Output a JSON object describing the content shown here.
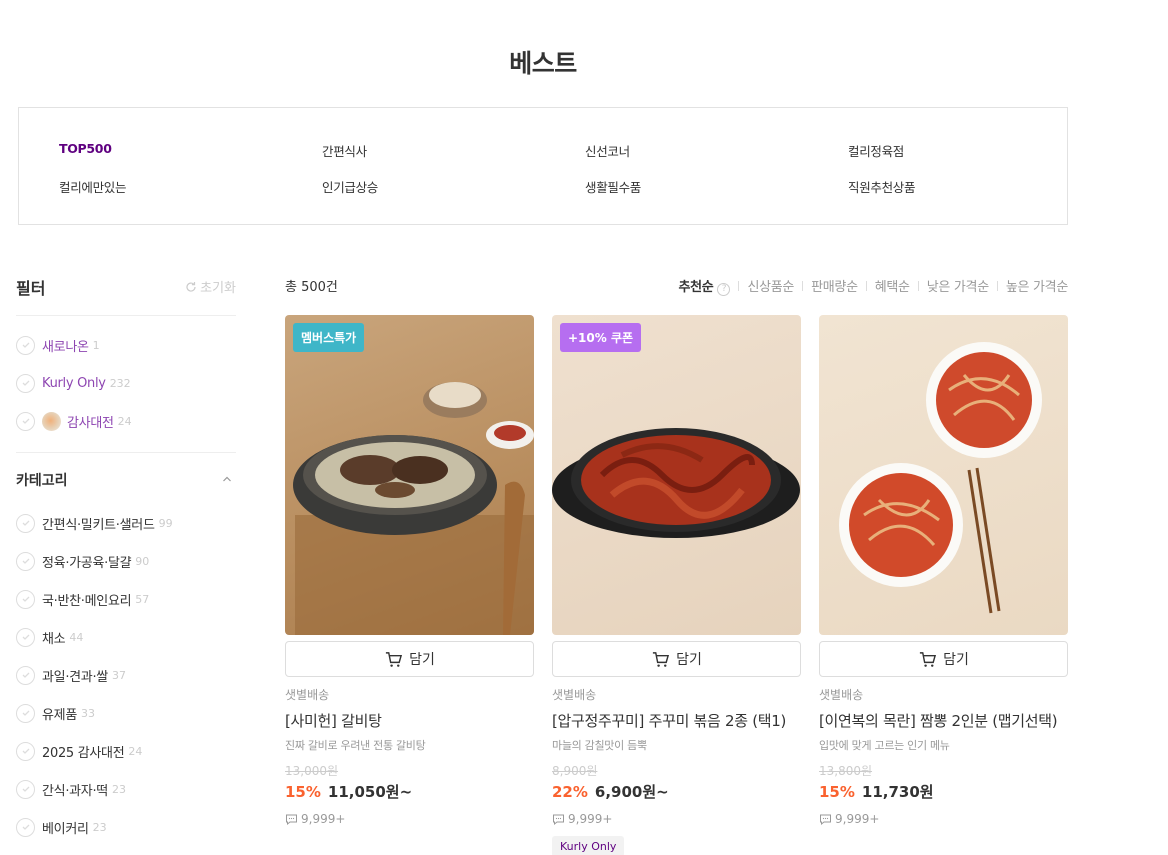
{
  "page": {
    "title": "베스트"
  },
  "categories": [
    {
      "label": "TOP500",
      "active": true
    },
    {
      "label": "간편식사"
    },
    {
      "label": "신선코너"
    },
    {
      "label": "컬리정육점"
    },
    {
      "label": "컬리에만있는"
    },
    {
      "label": "인기급상승"
    },
    {
      "label": "생활필수품"
    },
    {
      "label": "직원추천상품"
    }
  ],
  "filter": {
    "title": "필터",
    "reset_label": "초기화",
    "options": [
      {
        "label": "새로나온",
        "count": "1"
      },
      {
        "label": "Kurly Only",
        "count": "232"
      },
      {
        "label": "감사대전",
        "count": "24"
      }
    ],
    "category_title": "카테고리",
    "category_items": [
      {
        "label": "간편식·밀키트·샐러드",
        "count": "99"
      },
      {
        "label": "정육·가공육·달걀",
        "count": "90"
      },
      {
        "label": "국·반찬·메인요리",
        "count": "57"
      },
      {
        "label": "채소",
        "count": "44"
      },
      {
        "label": "과일·견과·쌀",
        "count": "37"
      },
      {
        "label": "유제품",
        "count": "33"
      },
      {
        "label": "2025 감사대전",
        "count": "24"
      },
      {
        "label": "간식·과자·떡",
        "count": "23"
      },
      {
        "label": "베이커리",
        "count": "23"
      }
    ]
  },
  "list": {
    "total": "총 500건",
    "sorts": [
      "추천순",
      "신상품순",
      "판매량순",
      "혜택순",
      "낮은 가격순",
      "높은 가격순"
    ],
    "help_glyph": "?"
  },
  "cart_label": "담기",
  "products": [
    {
      "badge": "멤버스특가",
      "badge_color": "#3fb6c8",
      "delivery": "샛별배송",
      "name": "[사미헌] 갈비탕",
      "desc": "진짜 갈비로 우려낸 전통 갈비탕",
      "original_price": "13,000원",
      "discount": "15%",
      "price": "11,050원~",
      "reviews": "9,999+",
      "tag": ""
    },
    {
      "badge": "+10% 쿠폰",
      "badge_color": "#b66ef0",
      "delivery": "샛별배송",
      "name": "[압구정주꾸미] 주꾸미 볶음 2종 (택1)",
      "desc": "마늘의 감칠맛이 듬뿍",
      "original_price": "8,900원",
      "discount": "22%",
      "price": "6,900원~",
      "reviews": "9,999+",
      "tag": "Kurly Only"
    },
    {
      "badge": "",
      "badge_color": "",
      "delivery": "샛별배송",
      "name": "[이연복의 목란] 짬뽕 2인분 (맵기선택)",
      "desc": "입맛에 맞게 고르는 인기 메뉴",
      "original_price": "13,800원",
      "discount": "15%",
      "price": "11,730원",
      "reviews": "9,999+",
      "tag": ""
    }
  ],
  "colors": {
    "brand": "#5f0080",
    "discount": "#fa622f"
  }
}
